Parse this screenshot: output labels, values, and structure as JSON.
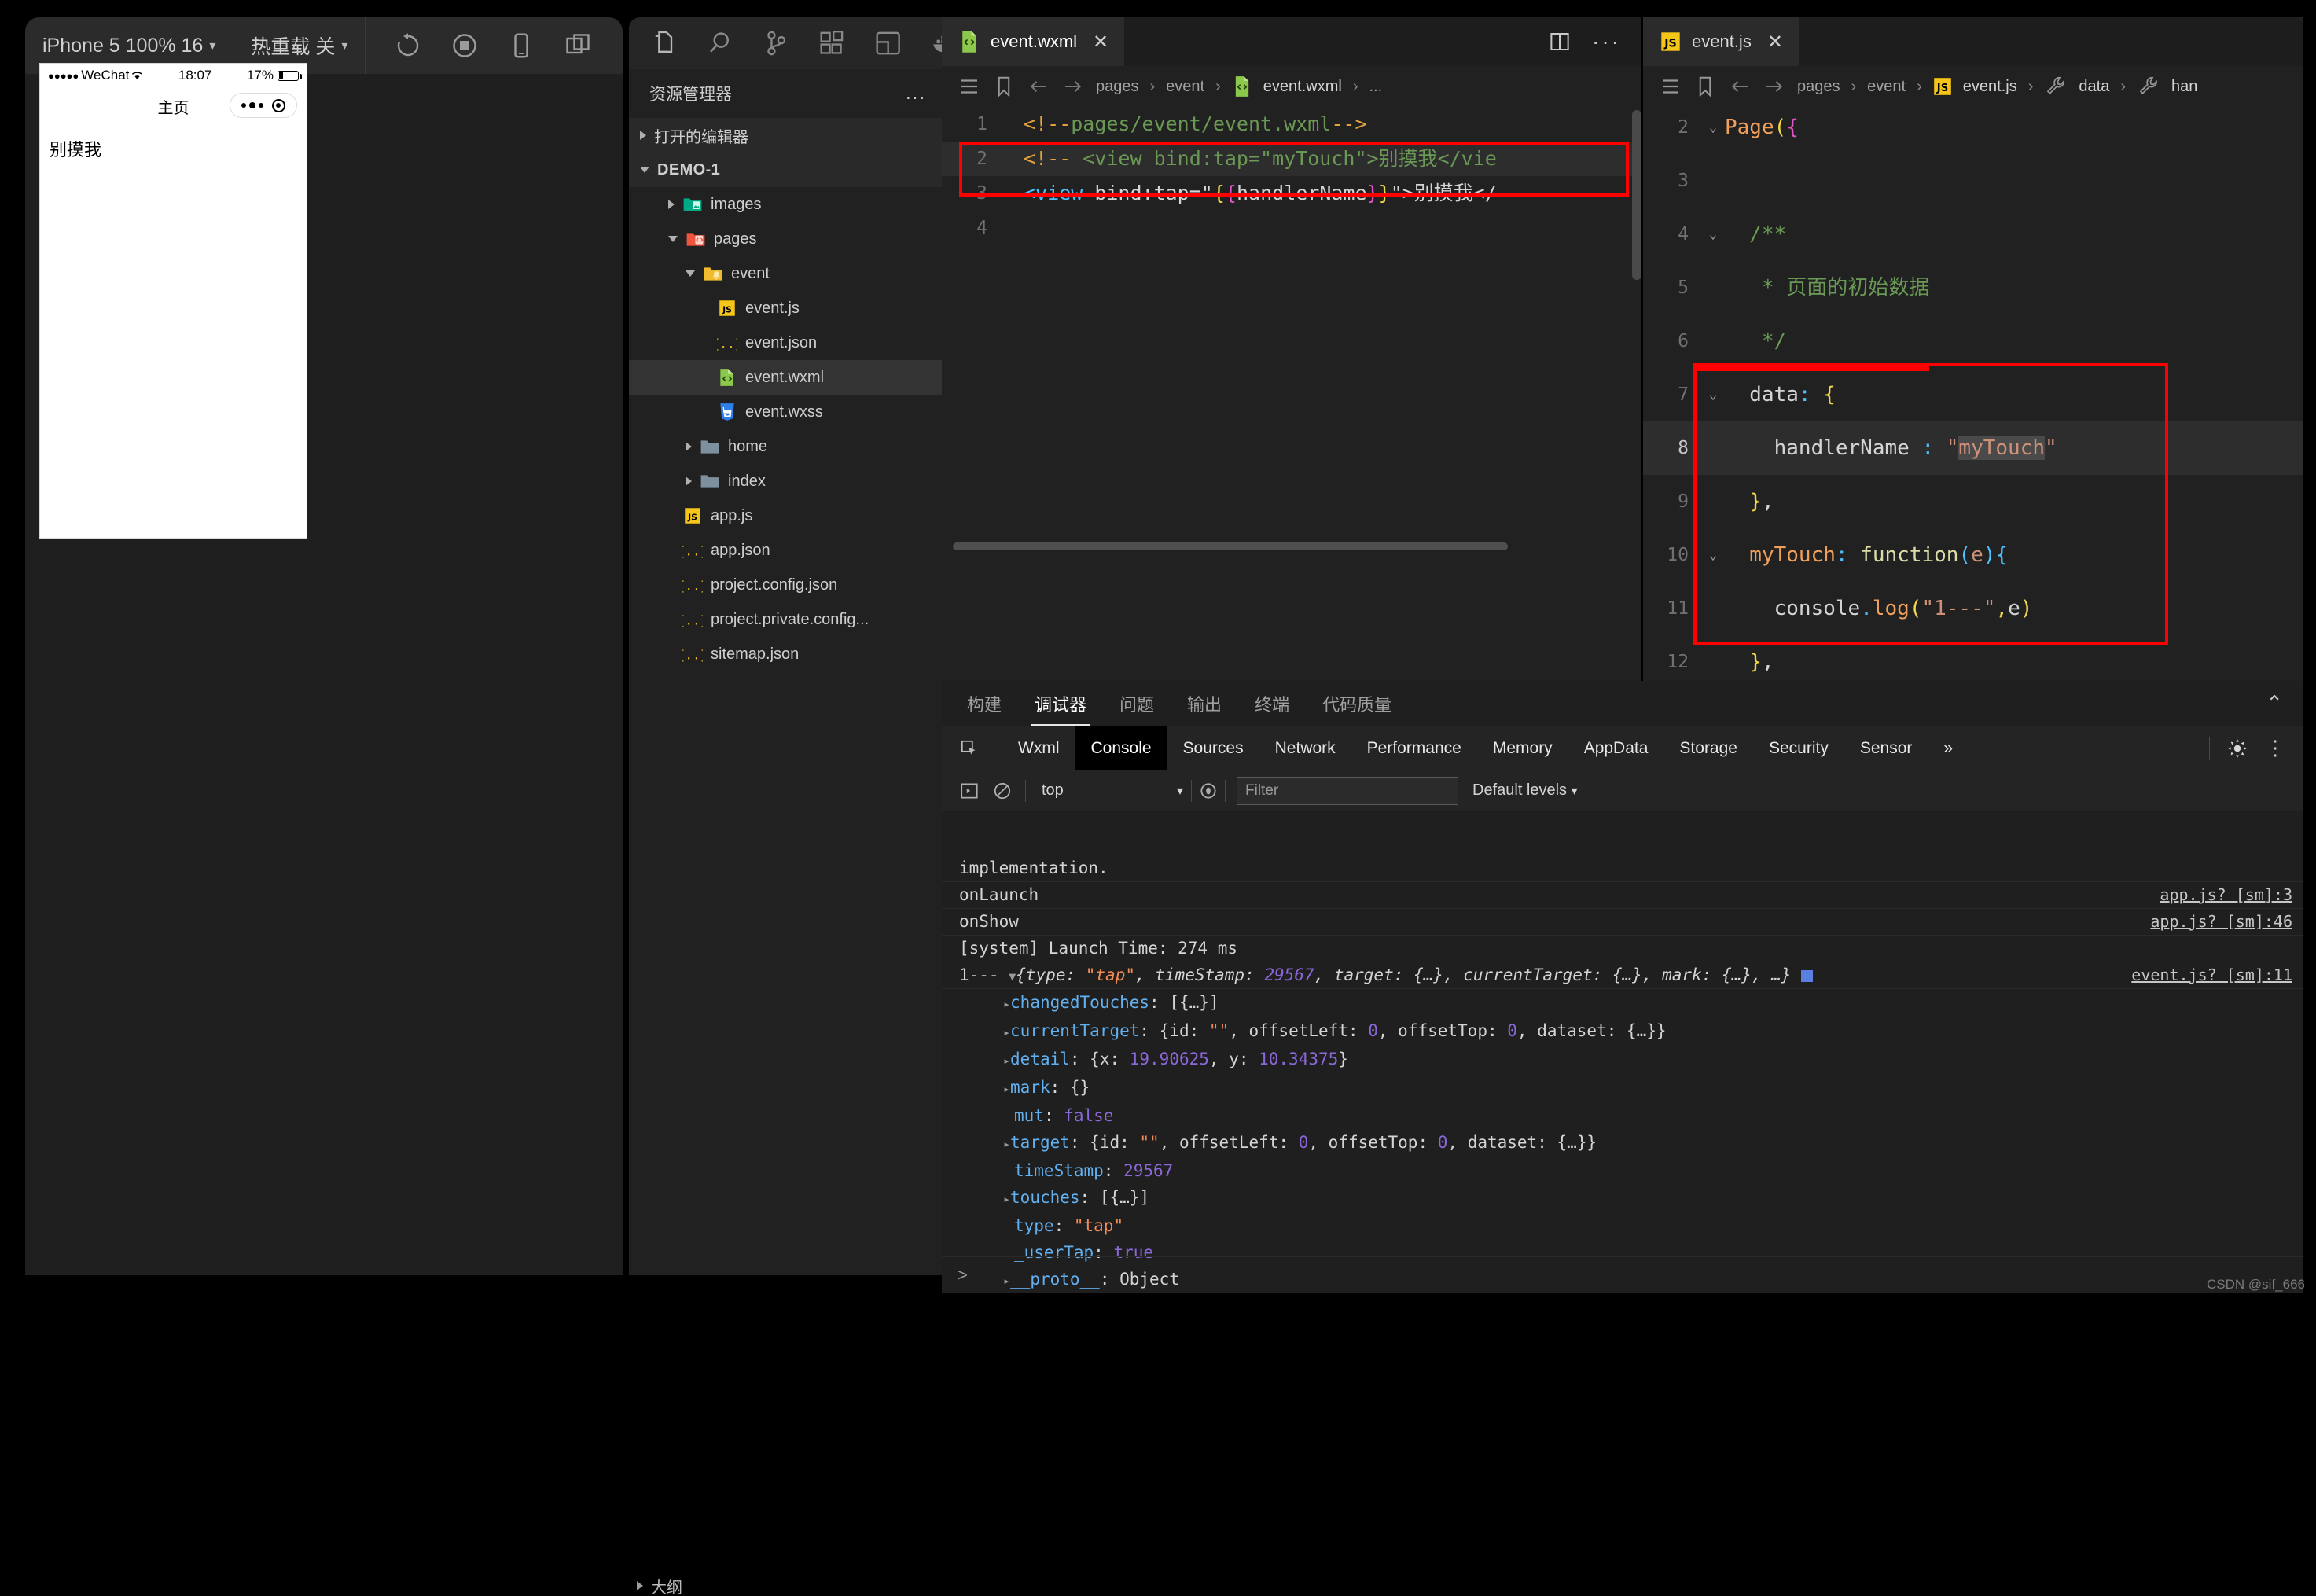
{
  "simulator": {
    "toolbar": {
      "device": "iPhone 5 100% 16",
      "hot_reload": "热重载 关",
      "icons": [
        "refresh-icon",
        "record-icon",
        "device-icon",
        "split-icon"
      ]
    },
    "status_bar": {
      "carrier": "WeChat",
      "signal_dots": "●●●●●",
      "time": "18:07",
      "battery_percent": "17%"
    },
    "nav_title": "主页",
    "page_text": "别摸我"
  },
  "activity_bar": {
    "icons": [
      "explorer-icon",
      "search-icon",
      "source-control-icon",
      "extensions-icon",
      "layout-icon",
      "docker-icon"
    ]
  },
  "explorer": {
    "title": "资源管理器",
    "more": "...",
    "open_editors": "打开的编辑器",
    "root": "DEMO-1",
    "items": [
      {
        "label": "images",
        "icon": "folder-images-icon",
        "depth": 1,
        "arrow": "right",
        "selected": false
      },
      {
        "label": "pages",
        "icon": "folder-pages-icon",
        "depth": 1,
        "arrow": "down",
        "selected": false
      },
      {
        "label": "event",
        "icon": "folder-event-icon",
        "depth": 2,
        "arrow": "down",
        "selected": false
      },
      {
        "label": "event.js",
        "icon": "js-icon",
        "depth": 3,
        "arrow": "none",
        "selected": false
      },
      {
        "label": "event.json",
        "icon": "json-icon",
        "depth": 3,
        "arrow": "none",
        "selected": false
      },
      {
        "label": "event.wxml",
        "icon": "wxml-icon",
        "depth": 3,
        "arrow": "none",
        "selected": true
      },
      {
        "label": "event.wxss",
        "icon": "wxss-icon",
        "depth": 3,
        "arrow": "none",
        "selected": false
      },
      {
        "label": "home",
        "icon": "folder-icon",
        "depth": 2,
        "arrow": "right",
        "selected": false
      },
      {
        "label": "index",
        "icon": "folder-icon",
        "depth": 2,
        "arrow": "right",
        "selected": false
      },
      {
        "label": "app.js",
        "icon": "js-icon",
        "depth": 1,
        "arrow": "none",
        "selected": false
      },
      {
        "label": "app.json",
        "icon": "json-icon",
        "depth": 1,
        "arrow": "none",
        "selected": false
      },
      {
        "label": "project.config.json",
        "icon": "json-icon",
        "depth": 1,
        "arrow": "none",
        "selected": false
      },
      {
        "label": "project.private.config...",
        "icon": "json-icon",
        "depth": 1,
        "arrow": "none",
        "selected": false
      },
      {
        "label": "sitemap.json",
        "icon": "json-icon",
        "depth": 1,
        "arrow": "none",
        "selected": false
      }
    ],
    "bottom_section": "大纲"
  },
  "editor_left": {
    "tab": {
      "label": "event.wxml",
      "icon": "wxml-icon",
      "close": "✕"
    },
    "breadcrumb": [
      "pages",
      "event",
      "event.wxml",
      "..."
    ],
    "breadcrumb_sep": "›",
    "lines": [
      {
        "n": "1",
        "fold": ""
      },
      {
        "n": "2",
        "fold": ""
      },
      {
        "n": "3",
        "fold": ""
      },
      {
        "n": "4",
        "fold": ""
      }
    ],
    "code": {
      "l1": "<!--pages/event/event.wxml-->",
      "l2": "<!-- <view bind:tap=\"myTouch\">别摸我<//vie",
      "l3": "<view bind:tap=\"{{handlerName}}\">别摸我</"
    }
  },
  "editor_right": {
    "tab": {
      "label": "event.js",
      "icon": "js-icon",
      "close": "✕"
    },
    "breadcrumb": [
      "pages",
      "event",
      "event.js",
      "data",
      "han"
    ],
    "breadcrumb_sep": "›",
    "lines": [
      {
        "n": "2",
        "text": "Page({"
      },
      {
        "n": "3",
        "text": ""
      },
      {
        "n": "4",
        "text": "/**"
      },
      {
        "n": "5",
        "text": "* 页面的初始数据"
      },
      {
        "n": "6",
        "text": "*/"
      },
      {
        "n": "7",
        "text": "data: {"
      },
      {
        "n": "8",
        "text": "handlerName : \"myTouch\""
      },
      {
        "n": "9",
        "text": "},"
      },
      {
        "n": "10",
        "text": "myTouch: function(e){"
      },
      {
        "n": "11",
        "text": "console.log(\"1---\",e)"
      },
      {
        "n": "12",
        "text": "},"
      }
    ]
  },
  "panel": {
    "tabs": [
      {
        "label": "构建",
        "active": false
      },
      {
        "label": "调试器",
        "active": true
      },
      {
        "label": "问题",
        "active": false
      },
      {
        "label": "输出",
        "active": false
      },
      {
        "label": "终端",
        "active": false
      },
      {
        "label": "代码质量",
        "active": false
      }
    ],
    "collapse_icon": "chevron-up-icon",
    "devtools_tabs": [
      {
        "label": "Wxml",
        "active": false
      },
      {
        "label": "Console",
        "active": true
      },
      {
        "label": "Sources",
        "active": false
      },
      {
        "label": "Network",
        "active": false
      },
      {
        "label": "Performance",
        "active": false
      },
      {
        "label": "Memory",
        "active": false
      },
      {
        "label": "AppData",
        "active": false
      },
      {
        "label": "Storage",
        "active": false
      },
      {
        "label": "Security",
        "active": false
      },
      {
        "label": "Sensor",
        "active": false
      }
    ],
    "devtools_overflow": "»",
    "console_toolbar": {
      "context": "top",
      "filter_placeholder": "Filter",
      "levels": "Default levels"
    },
    "console_messages": [
      {
        "text": "implementation.",
        "source": ""
      },
      {
        "text": "onLaunch",
        "source": "app.js? [sm]:3"
      },
      {
        "text": "onShow",
        "source": "app.js? [sm]:46"
      },
      {
        "text": "[system] Launch Time: 274 ms",
        "source": ""
      }
    ],
    "console_object": {
      "label": "1---",
      "summary_prefix": "{type: ",
      "summary_type": "\"tap\"",
      "summary_mid": ", timeStamp: ",
      "summary_ts": "29567",
      "summary_rest": ", target: {…}, currentTarget: {…}, mark: {…}, …}",
      "source": "event.js? [sm]:11",
      "props": [
        {
          "arrow": true,
          "key": "changedTouches",
          "value": ": [{…}]"
        },
        {
          "arrow": true,
          "key": "currentTarget",
          "value": ": {id: \"\", offsetLeft: 0, offsetTop: 0, dataset: {…}}"
        },
        {
          "arrow": true,
          "key": "detail",
          "value": ": {x: 19.90625, y: 10.34375}"
        },
        {
          "arrow": true,
          "key": "mark",
          "value": ": {}"
        },
        {
          "arrow": false,
          "key": "mut",
          "value": ": false"
        },
        {
          "arrow": true,
          "key": "target",
          "value": ": {id: \"\", offsetLeft: 0, offsetTop: 0, dataset: {…}}"
        },
        {
          "arrow": false,
          "key": "timeStamp",
          "value": ": 29567"
        },
        {
          "arrow": true,
          "key": "touches",
          "value": ": [{…}]"
        },
        {
          "arrow": false,
          "key": "type",
          "value": ": \"tap\""
        },
        {
          "arrow": false,
          "key": "_userTap",
          "value": ": true"
        },
        {
          "arrow": true,
          "key": "__proto__",
          "value": ": Object"
        }
      ]
    },
    "prompt": ">"
  },
  "watermark": "CSDN @sif_666",
  "colors": {
    "accent_red": "#fe0000",
    "editor_bg": "#212121",
    "panel_bg": "#1f1f1f",
    "sidebar_bg": "#212121"
  }
}
